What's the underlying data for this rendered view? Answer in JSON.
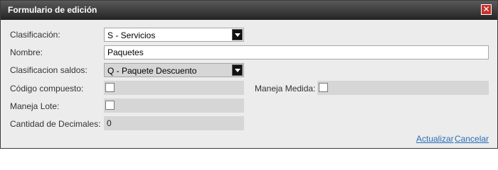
{
  "window": {
    "title": "Formulario de edición",
    "close_symbol": "✕"
  },
  "form": {
    "clasificacion": {
      "label": "Clasificación:",
      "value": "S - Servicios"
    },
    "nombre": {
      "label": "Nombre:",
      "value": "Paquetes"
    },
    "clasificacion_saldos": {
      "label": "Clasificacion saldos:",
      "value": "Q - Paquete Descuento"
    },
    "codigo_compuesto": {
      "label": "Código compuesto:",
      "checked": false
    },
    "maneja_medida": {
      "label": "Maneja Medida:",
      "checked": false
    },
    "maneja_lote": {
      "label": "Maneja Lote:",
      "checked": false
    },
    "cantidad_decimales": {
      "label": "Cantidad de Decimales:",
      "value": "0"
    }
  },
  "actions": {
    "actualizar_label": "Actualizar",
    "cancelar_label": "Cancelar"
  }
}
